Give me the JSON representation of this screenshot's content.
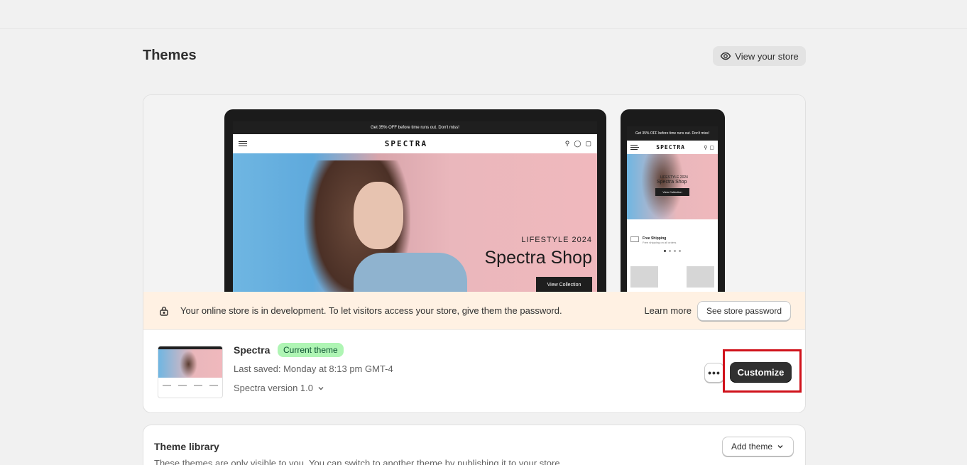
{
  "page": {
    "title": "Themes",
    "view_store_label": "View your store"
  },
  "preview": {
    "desktop": {
      "announcement": "Get 35% OFF before time runs out. Don't miss!",
      "logo": "SPECTRA",
      "hero_subtitle": "LIFESTYLE 2024",
      "hero_title": "Spectra Shop",
      "hero_button": "View Collection"
    },
    "mobile": {
      "announcement": "Get 35% OFF before time runs out. Don't miss!",
      "logo": "SPECTRA",
      "hero_subtitle": "LIFESTYLE 2024",
      "hero_title": "Spectra Shop",
      "hero_button": "View Collection",
      "shipping_title": "Free Shipping",
      "shipping_subtitle": "Free shipping on all orders"
    }
  },
  "banner": {
    "message": "Your online store is in development. To let visitors access your store, give them the password.",
    "learn_more": "Learn more",
    "button": "See store password"
  },
  "current_theme": {
    "name": "Spectra",
    "badge": "Current theme",
    "last_saved": "Last saved: Monday at 8:13 pm GMT-4",
    "version": "Spectra version 1.0",
    "more_label": "•••",
    "customize_label": "Customize"
  },
  "library": {
    "title": "Theme library",
    "description": "These themes are only visible to you. You can switch to another theme by publishing it to your store.",
    "add_theme_label": "Add theme"
  },
  "colors": {
    "page_bg": "#f1f1f1",
    "banner_bg": "#fff1e3",
    "badge_bg": "#aff5b4",
    "primary_button": "#303030",
    "highlight": "#d0121b"
  },
  "icons": {
    "view_store": "eye-icon",
    "banner": "lock-icon",
    "version": "chevron-down-icon",
    "add_theme": "chevron-down-icon"
  }
}
